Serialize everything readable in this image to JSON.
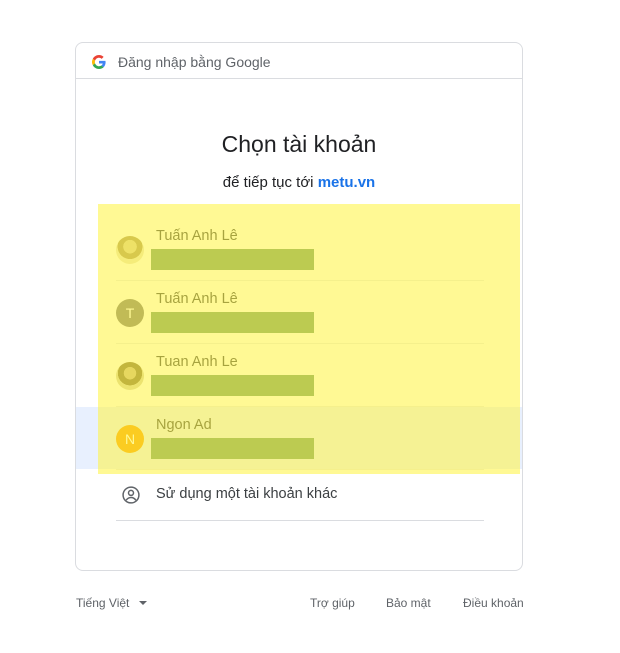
{
  "header": {
    "text": "Đăng nhập bằng Google",
    "logo_icon": "google-g-icon"
  },
  "title": "Chọn tài khoản",
  "subtitle": {
    "prefix": "để tiếp tục tới",
    "site": "metu.vn"
  },
  "accounts": [
    {
      "name": "Tuấn Anh Lê",
      "avatar": "photo"
    },
    {
      "name": "Tuấn Anh Lê",
      "avatar": "letter",
      "letter": "T"
    },
    {
      "name": "Tuan Anh Le",
      "avatar": "photo"
    },
    {
      "name": "Ngon Ad",
      "avatar": "letter",
      "letter": "N"
    }
  ],
  "other_account": {
    "label": "Sử dụng một tài khoản khác",
    "icon": "person-circle-icon"
  },
  "footer": {
    "language": "Tiếng Việt",
    "help": "Trợ giúp",
    "privacy": "Bảo mật",
    "terms": "Điều khoản"
  },
  "colors": {
    "accent": "#1a73e8",
    "hover_row": "#e8f0fe",
    "avatar_t": "#757575",
    "avatar_n": "#f59c00",
    "highlight": "#fff43c",
    "redaction": "#6a9a6c"
  }
}
